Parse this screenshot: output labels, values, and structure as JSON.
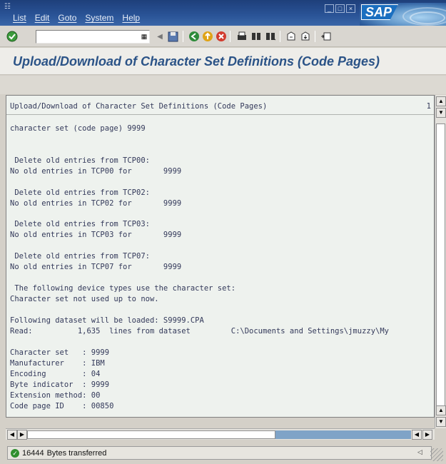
{
  "menu": {
    "items": [
      "List",
      "Edit",
      "Goto",
      "System",
      "Help"
    ]
  },
  "toolbar": {
    "command_field_value": "",
    "icons": [
      "enter-icon",
      "save-icon",
      "back-icon",
      "exit-icon",
      "cancel-icon",
      "print-icon",
      "find-icon",
      "find-next-icon",
      "first-page-icon",
      "last-page-icon",
      "layout-icon"
    ]
  },
  "title": "Upload/Download of Character Set Definitions (Code Pages)",
  "list": {
    "header": "Upload/Download of Character Set Definitions (Code Pages)",
    "page_number": "1",
    "lines": [
      "character set (code page) 9999",
      "",
      " Delete old entries from TCP00:",
      "No old entries in TCP00 for       9999",
      "",
      " Delete old entries from TCP02:",
      "No old entries in TCP02 for       9999",
      "",
      " Delete old entries from TCP03:",
      "No old entries in TCP03 for       9999",
      "",
      " Delete old entries from TCP07:",
      "No old entries in TCP07 for       9999",
      "",
      " The following device types use the character set:",
      "Character set not used up to now.",
      "",
      "Following dataset will be loaded: S9999.CPA",
      "Read:          1,635  lines from dataset         C:\\Documents and Settings\\jmuzzy\\My",
      "",
      "Character set   : 9999",
      "Manufacturer    : IBM",
      "Encoding        : 04",
      "Byte indicator  : 9999",
      "Extension method: 00",
      "Code page ID    : 00850"
    ]
  },
  "status": {
    "count": "16444",
    "message": "Bytes transferred"
  },
  "colors": {
    "title": "#2b5387",
    "list_text": "#33395a",
    "status_ok": "#2f8f2f"
  }
}
